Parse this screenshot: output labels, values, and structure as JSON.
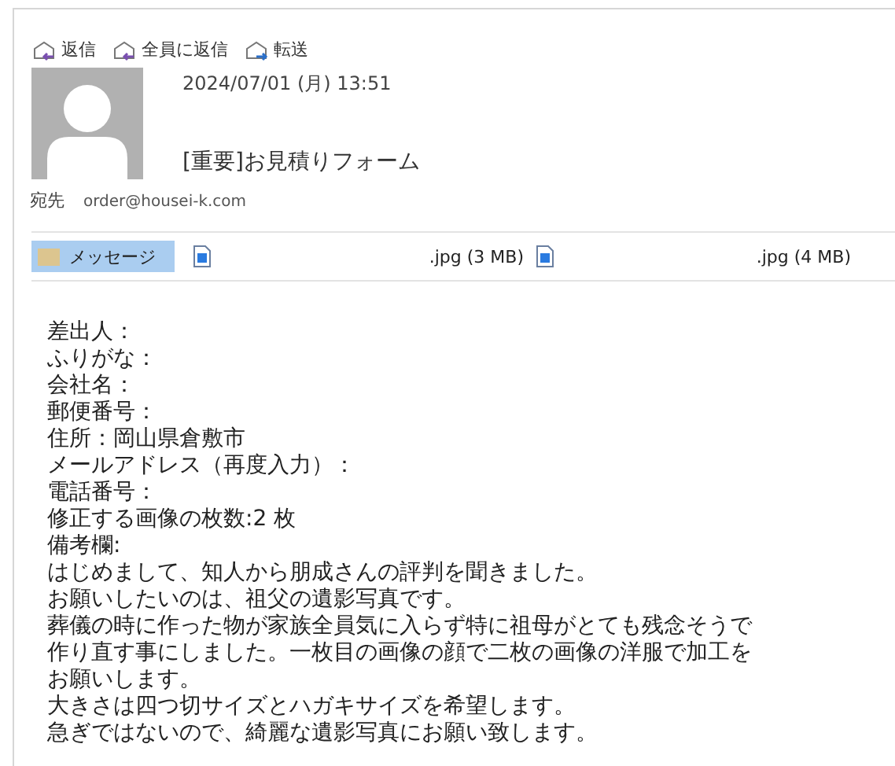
{
  "actions": [
    {
      "label": "返信",
      "kind": "reply"
    },
    {
      "label": "全員に返信",
      "kind": "reply-all"
    },
    {
      "label": "転送",
      "kind": "forward"
    }
  ],
  "header": {
    "date": "2024/07/01 (月) 13:51",
    "subject": "[重要]お見積りフォーム",
    "to_label": "宛先",
    "to": "order@housei-k.com"
  },
  "attachments": [
    {
      "kind": "message",
      "label": "メッセージ",
      "selected": true
    },
    {
      "kind": "file",
      "label": ".jpg (3 MB)",
      "selected": false
    },
    {
      "kind": "file",
      "label": ".jpg (4 MB)",
      "selected": false
    }
  ],
  "body": [
    "差出人：",
    "ふりがな：",
    "会社名：",
    "郵便番号：",
    "住所：岡山県倉敷市",
    "メールアドレス（再度入力）：",
    "電話番号：",
    "修正する画像の枚数:2 枚",
    "備考欄:",
    "はじめまして、知人から朋成さんの評判を聞きました。",
    "お願いしたいのは、祖父の遺影写真です。",
    "葬儀の時に作った物が家族全員気に入らず特に祖母がとても残念そうで",
    "作り直す事にしました。一枚目の画像の顔で二枚の画像の洋服で加工を",
    "お願いします。",
    "大きさは四つ切サイズとハガキサイズを希望します。",
    "急ぎではないので、綺麗な遺影写真にお願い致します。"
  ]
}
